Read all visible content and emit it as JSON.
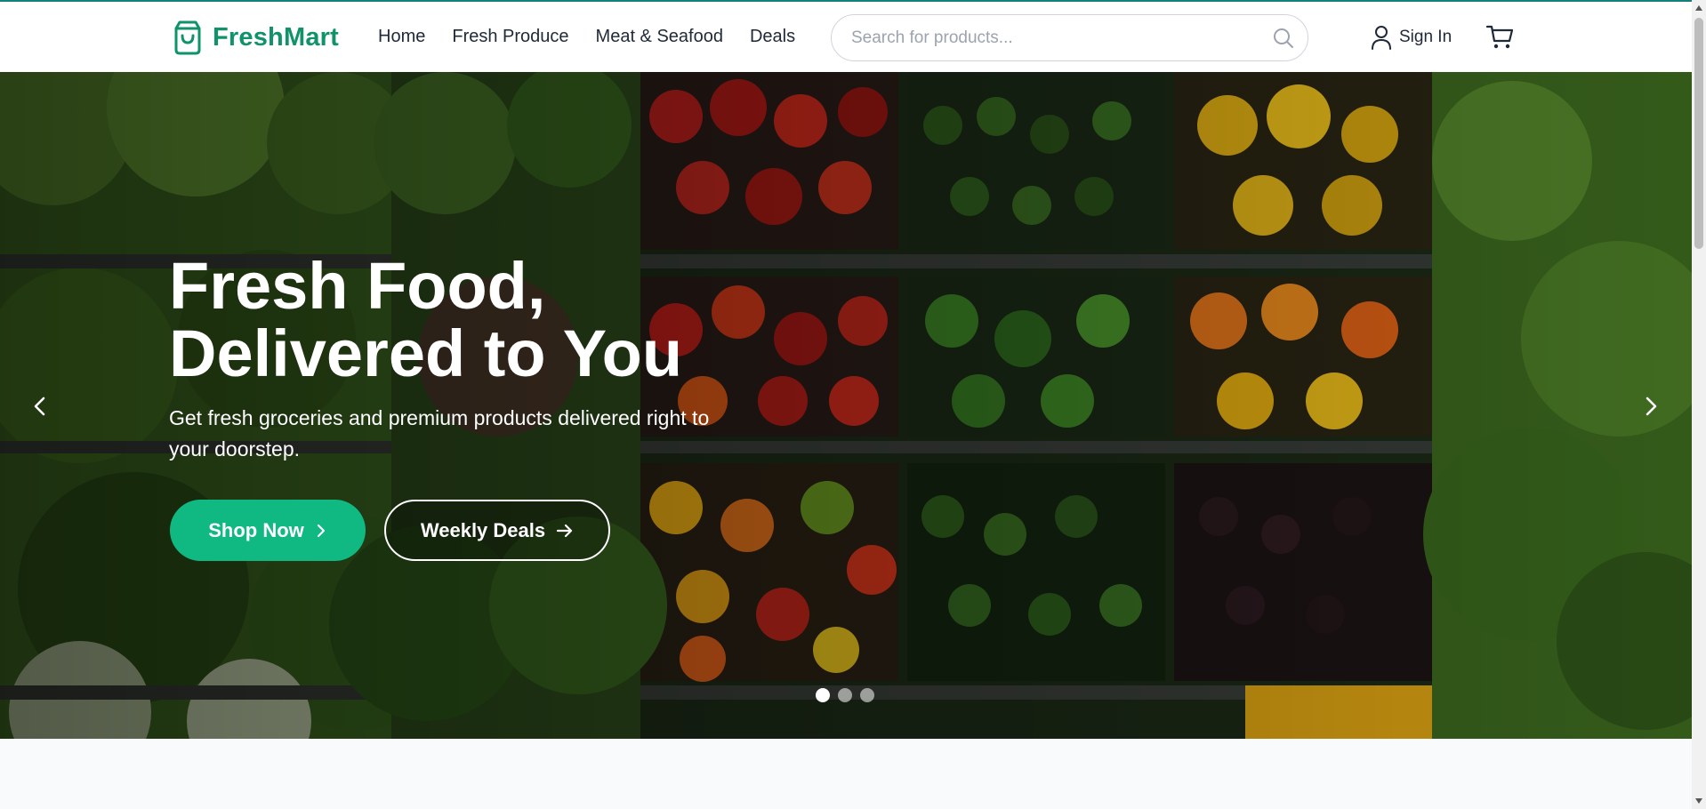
{
  "brand": {
    "name": "FreshMart",
    "color": "#10926a"
  },
  "nav": {
    "items": [
      {
        "label": "Home"
      },
      {
        "label": "Fresh Produce"
      },
      {
        "label": "Meat & Seafood"
      },
      {
        "label": "Deals"
      }
    ]
  },
  "search": {
    "placeholder": "Search for products...",
    "value": "",
    "icon": "search-icon"
  },
  "account": {
    "signin_label": "Sign In",
    "icon": "user-icon"
  },
  "cart": {
    "icon": "cart-icon"
  },
  "hero": {
    "title_line1": "Fresh Food,",
    "title_line2": "Delivered to You",
    "subtitle": "Get fresh groceries and premium products delivered right to your doorstep.",
    "primary_button": "Shop Now",
    "secondary_button": "Weekly Deals",
    "accent_color": "#10b981",
    "slides_total": 3,
    "active_slide": 1
  }
}
